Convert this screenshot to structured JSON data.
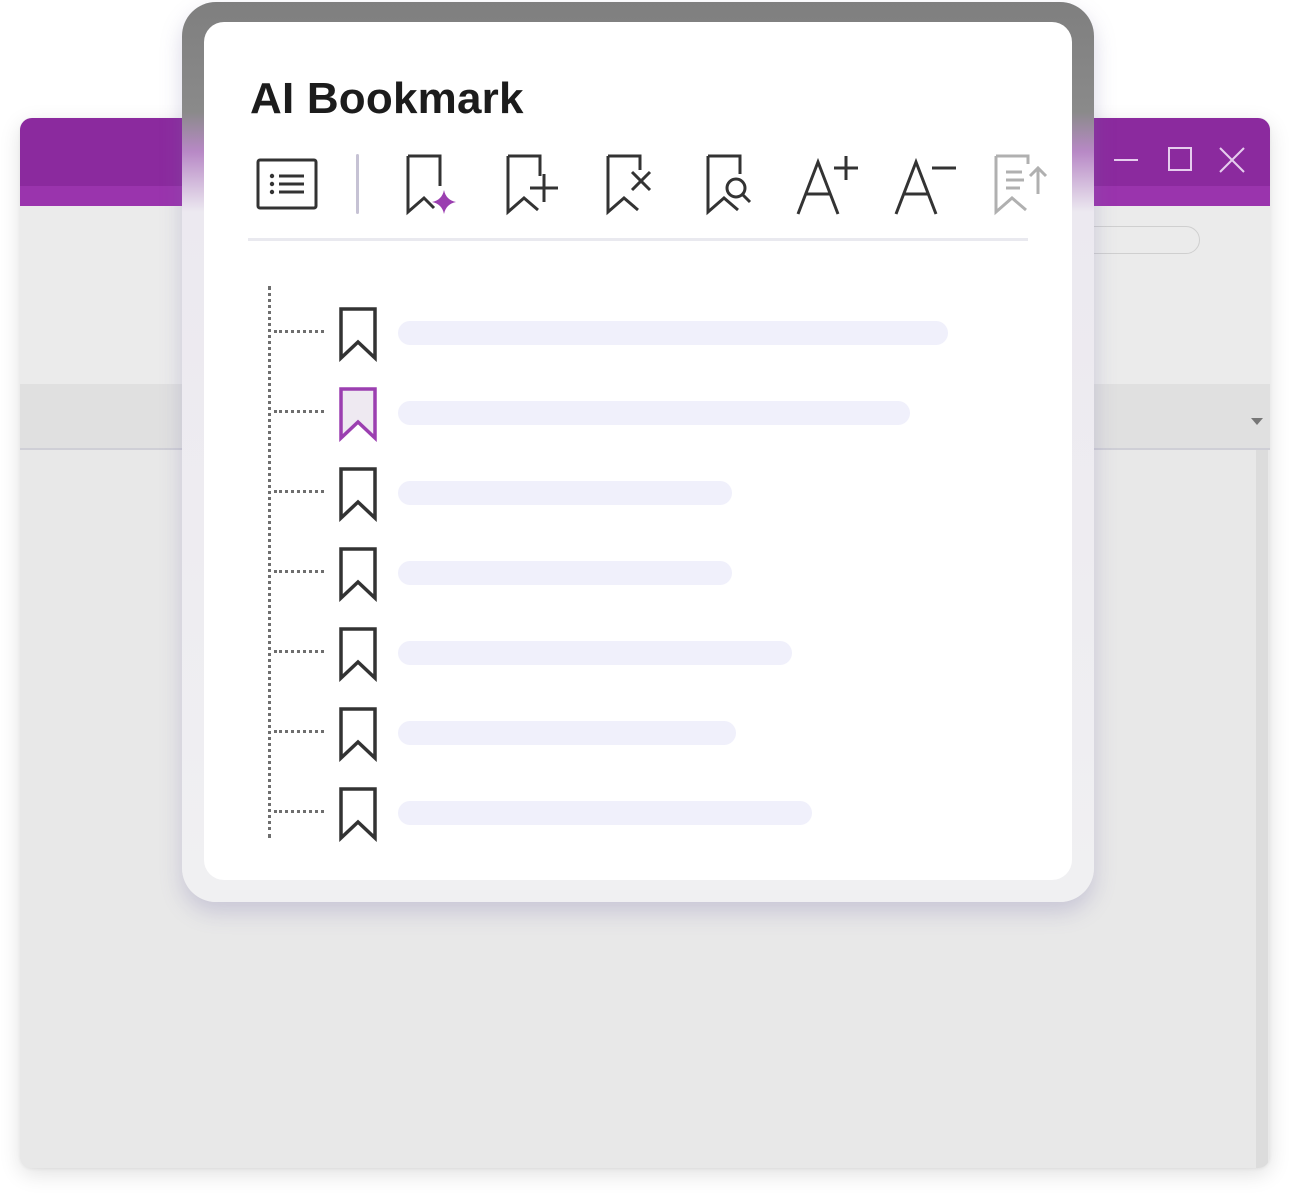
{
  "panel": {
    "title": "AI Bookmark",
    "toolbar": [
      {
        "icon": "bookmark-list-icon"
      },
      {
        "icon": "ai-bookmark-icon"
      },
      {
        "icon": "add-bookmark-icon"
      },
      {
        "icon": "delete-bookmark-icon"
      },
      {
        "icon": "search-bookmark-icon"
      },
      {
        "icon": "increase-font-icon"
      },
      {
        "icon": "decrease-font-icon"
      },
      {
        "icon": "sort-bookmarks-icon"
      }
    ],
    "bookmarks": [
      {
        "label": "",
        "selected": false
      },
      {
        "label": "",
        "selected": true
      },
      {
        "label": "",
        "selected": false
      },
      {
        "label": "",
        "selected": false
      },
      {
        "label": "",
        "selected": false
      },
      {
        "label": "",
        "selected": false
      },
      {
        "label": "",
        "selected": false
      }
    ]
  },
  "window": {
    "controls": [
      "minimize-icon",
      "maximize-icon",
      "close-icon"
    ]
  },
  "colors": {
    "accent": "#8b2a9e",
    "selected_bookmark": "#9b3fb0",
    "placeholder_bar": "#f0f0fb"
  }
}
